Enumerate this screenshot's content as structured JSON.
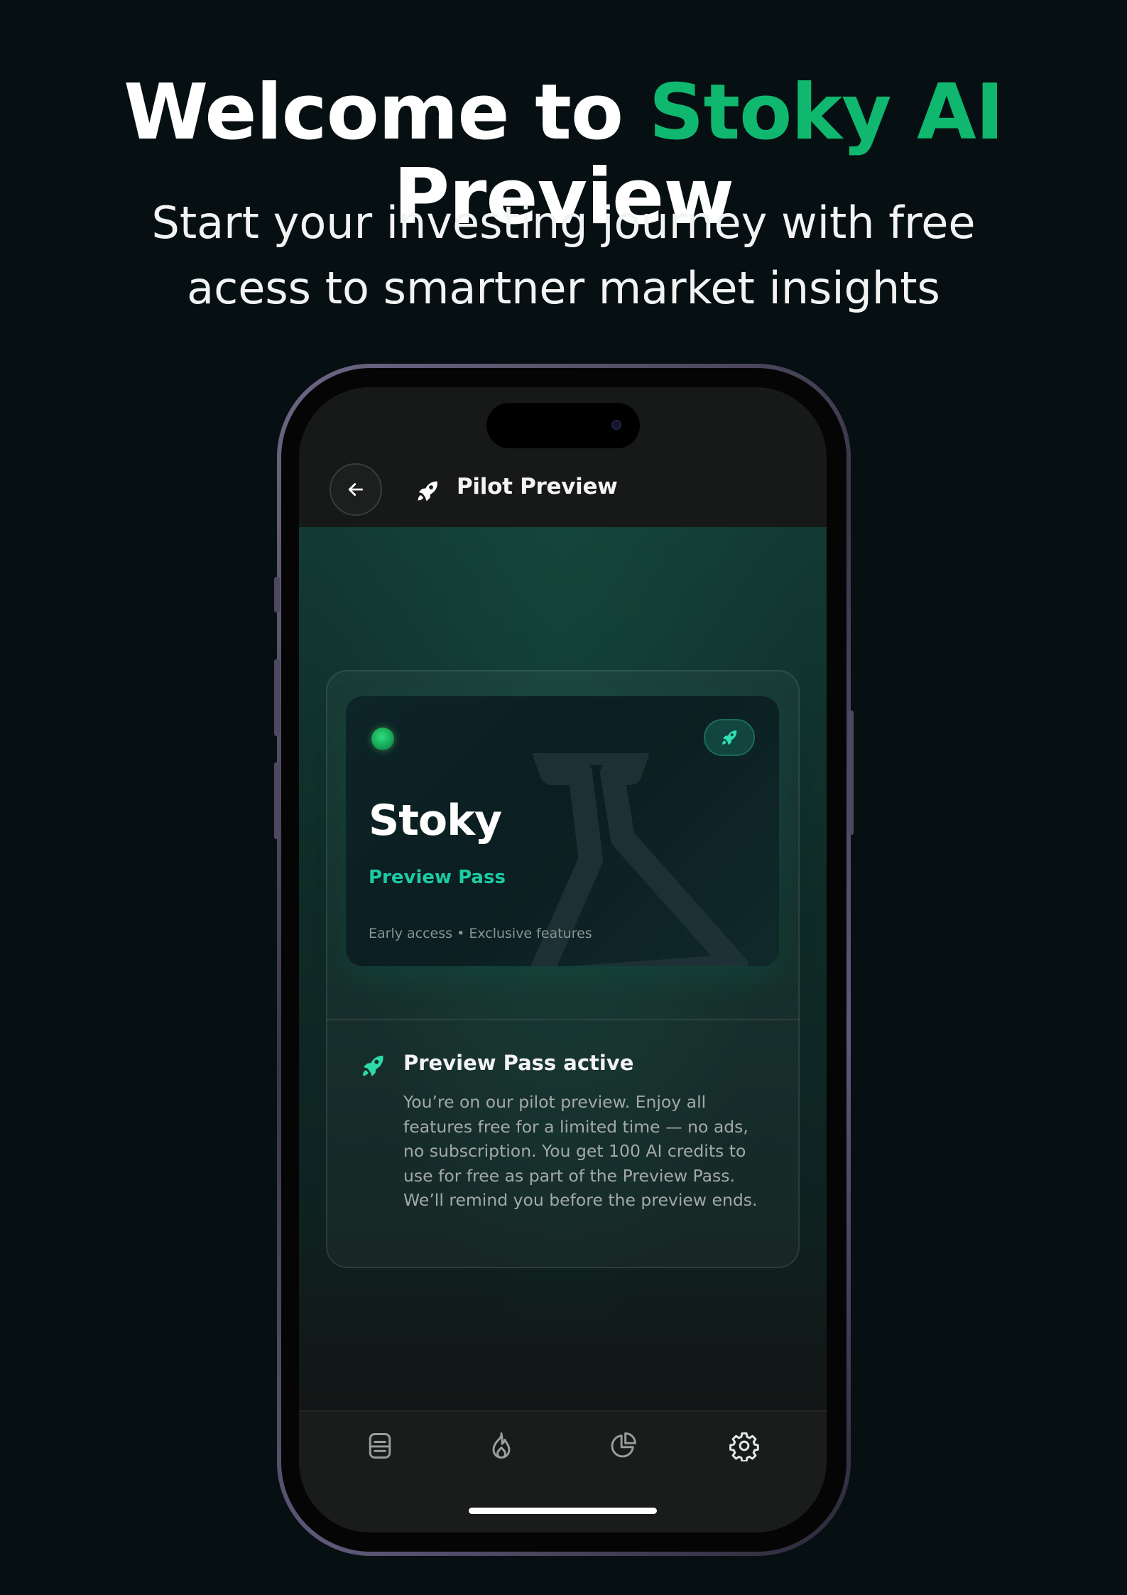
{
  "marketing": {
    "headline_pre": "Welcome to ",
    "headline_brand": "Stoky AI",
    "headline_post": " Preview",
    "subhead_line1": "Start your investing journey with free",
    "subhead_line2": "acess to smartner market insights"
  },
  "appbar": {
    "title": "Pilot Preview",
    "back_icon": "arrow-left-icon",
    "title_icon": "rocket-icon"
  },
  "pass_card": {
    "brand": "Stoky",
    "subtitle": "Preview Pass",
    "meta": "Early access • Exclusive features",
    "chip_icon": "rocket-icon",
    "watermark_icon": "flask-icon"
  },
  "info": {
    "title": "Preview Pass active",
    "body": "You’re on our pilot preview. Enjoy all features free for a limited time — no ads, no subscription. You get 100 AI credits to use for free as part of the Preview Pass. We’ll remind you before the preview ends.",
    "icon": "rocket-icon"
  },
  "tabbar": {
    "items": [
      {
        "icon": "list-icon"
      },
      {
        "icon": "flame-icon"
      },
      {
        "icon": "pie-chart-icon"
      },
      {
        "icon": "gear-icon"
      }
    ]
  },
  "colors": {
    "background": "#061012",
    "brand_green": "#10b86f",
    "teal_accent": "#1ccaa4",
    "screen": "#151616"
  }
}
